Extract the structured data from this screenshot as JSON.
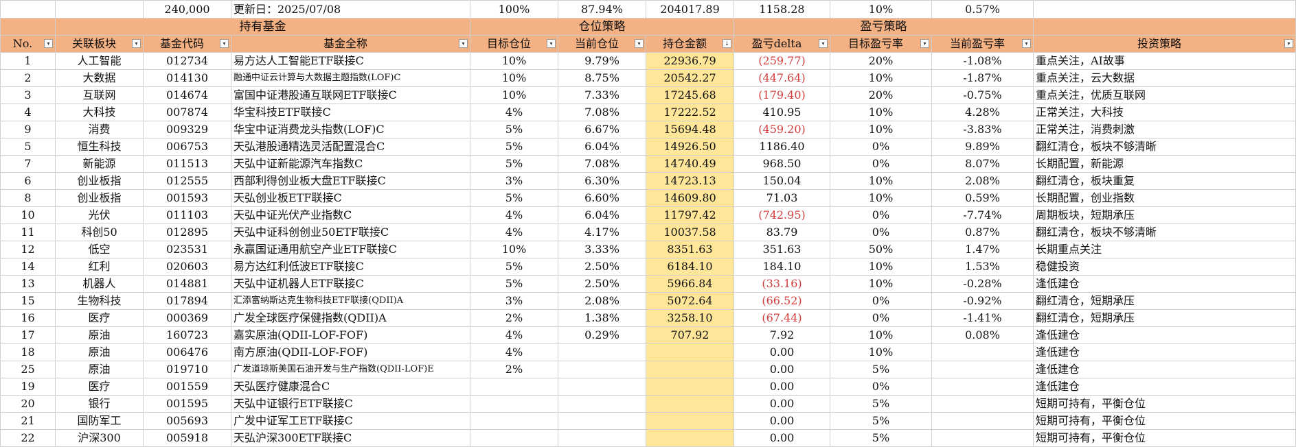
{
  "summary": {
    "total": "240,000",
    "updated": "更新日：2025/07/08",
    "target_total": "100%",
    "current_total": "87.94%",
    "amount_total": "204017.89",
    "delta_total": "1158.28",
    "target_rate": "10%",
    "current_rate": "0.57%"
  },
  "groups": {
    "holdings": "持有基金",
    "position": "仓位策略",
    "pnl": "盈亏策略"
  },
  "headers": {
    "no": "No.",
    "sector": "关联板块",
    "code": "基金代码",
    "name": "基金全称",
    "target_pos": "目标仓位",
    "current_pos": "当前仓位",
    "amount": "持仓金额",
    "delta": "盈亏delta",
    "target_rate": "目标盈亏率",
    "current_rate": "当前盈亏率",
    "strategy": "投资策略"
  },
  "filter_icons": {
    "normal": "▾",
    "sorted": "↓"
  },
  "rows": [
    {
      "no": "1",
      "sector": "人工智能",
      "code": "012734",
      "name": "易方达人工智能ETF联接C",
      "target": "10%",
      "current": "9.79%",
      "amount": "22936.79",
      "delta": "(259.77)",
      "target_rate": "20%",
      "current_rate": "-1.08%",
      "strategy": "重点关注，AI故事"
    },
    {
      "no": "2",
      "sector": "大数据",
      "code": "014130",
      "name": "融通中证云计算与大数据主题指数(LOF)C",
      "target": "10%",
      "current": "8.75%",
      "amount": "20542.27",
      "delta": "(447.64)",
      "target_rate": "10%",
      "current_rate": "-1.87%",
      "strategy": "重点关注，云大数据"
    },
    {
      "no": "3",
      "sector": "互联网",
      "code": "014674",
      "name": "富国中证港股通互联网ETF联接C",
      "target": "10%",
      "current": "7.33%",
      "amount": "17245.68",
      "delta": "(179.40)",
      "target_rate": "20%",
      "current_rate": "-0.75%",
      "strategy": "重点关注，优质互联网"
    },
    {
      "no": "4",
      "sector": "大科技",
      "code": "007874",
      "name": "华宝科技ETF联接C",
      "target": "4%",
      "current": "7.08%",
      "amount": "17222.52",
      "delta": "410.95",
      "target_rate": "10%",
      "current_rate": "4.28%",
      "strategy": "正常关注，大科技"
    },
    {
      "no": "9",
      "sector": "消费",
      "code": "009329",
      "name": "华宝中证消费龙头指数(LOF)C",
      "target": "5%",
      "current": "6.67%",
      "amount": "15694.48",
      "delta": "(459.20)",
      "target_rate": "10%",
      "current_rate": "-3.83%",
      "strategy": "正常关注，消费刺激"
    },
    {
      "no": "5",
      "sector": "恒生科技",
      "code": "006753",
      "name": "天弘港股通精选灵活配置混合C",
      "target": "5%",
      "current": "6.04%",
      "amount": "14926.50",
      "delta": "1186.40",
      "target_rate": "0%",
      "current_rate": "9.89%",
      "strategy": "翻红清仓，板块不够清晰"
    },
    {
      "no": "7",
      "sector": "新能源",
      "code": "011513",
      "name": "天弘中证新能源汽车指数C",
      "target": "5%",
      "current": "7.08%",
      "amount": "14740.49",
      "delta": "968.50",
      "target_rate": "0%",
      "current_rate": "8.07%",
      "strategy": "长期配置，新能源"
    },
    {
      "no": "6",
      "sector": "创业板指",
      "code": "012555",
      "name": "西部利得创业板大盘ETF联接C",
      "target": "3%",
      "current": "6.30%",
      "amount": "14723.13",
      "delta": "150.04",
      "target_rate": "10%",
      "current_rate": "2.08%",
      "strategy": "翻红清仓，板块重复"
    },
    {
      "no": "8",
      "sector": "创业板指",
      "code": "001593",
      "name": "天弘创业板ETF联接C",
      "target": "5%",
      "current": "6.60%",
      "amount": "14609.80",
      "delta": "71.03",
      "target_rate": "10%",
      "current_rate": "0.59%",
      "strategy": "长期配置，创业指数"
    },
    {
      "no": "10",
      "sector": "光伏",
      "code": "011103",
      "name": "天弘中证光伏产业指数C",
      "target": "4%",
      "current": "6.04%",
      "amount": "11797.42",
      "delta": "(742.95)",
      "target_rate": "0%",
      "current_rate": "-7.74%",
      "strategy": "周期板块，短期承压"
    },
    {
      "no": "11",
      "sector": "科创50",
      "code": "012895",
      "name": "天弘中证科创创业50ETF联接C",
      "target": "4%",
      "current": "4.17%",
      "amount": "10037.58",
      "delta": "83.79",
      "target_rate": "0%",
      "current_rate": "0.87%",
      "strategy": "翻红清仓，板块不够清晰"
    },
    {
      "no": "12",
      "sector": "低空",
      "code": "023531",
      "name": "永赢国证通用航空产业ETF联接C",
      "target": "10%",
      "current": "3.33%",
      "amount": "8351.63",
      "delta": "351.63",
      "target_rate": "50%",
      "current_rate": "1.47%",
      "strategy": "长期重点关注"
    },
    {
      "no": "14",
      "sector": "红利",
      "code": "020603",
      "name": "易方达红利低波ETF联接C",
      "target": "5%",
      "current": "2.50%",
      "amount": "6184.10",
      "delta": "184.10",
      "target_rate": "10%",
      "current_rate": "1.53%",
      "strategy": "稳健投资"
    },
    {
      "no": "13",
      "sector": "机器人",
      "code": "014881",
      "name": "天弘中证机器人ETF联接C",
      "target": "5%",
      "current": "2.50%",
      "amount": "5966.84",
      "delta": "(33.16)",
      "target_rate": "10%",
      "current_rate": "-0.28%",
      "strategy": "逢低建仓"
    },
    {
      "no": "15",
      "sector": "生物科技",
      "code": "017894",
      "name": "汇添富纳斯达克生物科技ETF联接(QDII)A",
      "target": "3%",
      "current": "2.08%",
      "amount": "5072.64",
      "delta": "(66.52)",
      "target_rate": "0%",
      "current_rate": "-0.92%",
      "strategy": "翻红清仓，短期承压"
    },
    {
      "no": "16",
      "sector": "医疗",
      "code": "000369",
      "name": "广发全球医疗保健指数(QDII)A",
      "target": "2%",
      "current": "1.38%",
      "amount": "3258.10",
      "delta": "(67.44)",
      "target_rate": "0%",
      "current_rate": "-1.41%",
      "strategy": "翻红清仓，短期承压"
    },
    {
      "no": "17",
      "sector": "原油",
      "code": "160723",
      "name": "嘉实原油(QDII-LOF-FOF)",
      "target": "4%",
      "current": "0.29%",
      "amount": "707.92",
      "delta": "7.92",
      "target_rate": "10%",
      "current_rate": "0.08%",
      "strategy": "逢低建仓"
    },
    {
      "no": "18",
      "sector": "原油",
      "code": "006476",
      "name": "南方原油(QDII-LOF-FOF)",
      "target": "4%",
      "current": "",
      "amount": "",
      "delta": "0.00",
      "target_rate": "10%",
      "current_rate": "",
      "strategy": "逢低建仓"
    },
    {
      "no": "25",
      "sector": "原油",
      "code": "019710",
      "name": "广发道琼斯美国石油开发与生产指数(QDII-LOF)E",
      "target": "2%",
      "current": "",
      "amount": "",
      "delta": "0.00",
      "target_rate": "5%",
      "current_rate": "",
      "strategy": "逢低建仓"
    },
    {
      "no": "19",
      "sector": "医疗",
      "code": "001559",
      "name": "天弘医疗健康混合C",
      "target": "",
      "current": "",
      "amount": "",
      "delta": "0.00",
      "target_rate": "0%",
      "current_rate": "",
      "strategy": "逢低建仓"
    },
    {
      "no": "20",
      "sector": "银行",
      "code": "001595",
      "name": "天弘中证银行ETF联接C",
      "target": "",
      "current": "",
      "amount": "",
      "delta": "0.00",
      "target_rate": "5%",
      "current_rate": "",
      "strategy": "短期可持有，平衡仓位"
    },
    {
      "no": "21",
      "sector": "国防军工",
      "code": "005693",
      "name": "广发中证军工ETF联接C",
      "target": "",
      "current": "",
      "amount": "",
      "delta": "0.00",
      "target_rate": "5%",
      "current_rate": "",
      "strategy": "短期可持有，平衡仓位"
    },
    {
      "no": "22",
      "sector": "沪深300",
      "code": "005918",
      "name": "天弘沪深300ETF联接C",
      "target": "",
      "current": "",
      "amount": "",
      "delta": "0.00",
      "target_rate": "5%",
      "current_rate": "",
      "strategy": "短期可持有，平衡仓位"
    }
  ],
  "colors": {
    "header_bg": "#f4b183",
    "amount_bg": "#ffe699",
    "negative": "#d33c3c"
  }
}
